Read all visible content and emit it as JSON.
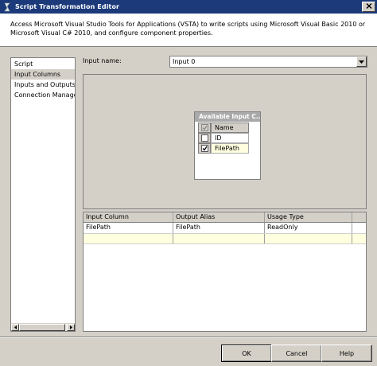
{
  "window": {
    "title": "Script Transformation Editor",
    "app_icon": "ssis-script-icon"
  },
  "header": {
    "description": "Access Microsoft Visual Studio Tools for Applications (VSTA) to write scripts using Microsoft Visual Basic 2010 or Microsoft Visual C# 2010, and configure component properties."
  },
  "sidebar": {
    "items": [
      {
        "label": "Script",
        "selected": false
      },
      {
        "label": "Input Columns",
        "selected": true
      },
      {
        "label": "Inputs and Outputs",
        "selected": false
      },
      {
        "label": "Connection Managers",
        "selected": false
      }
    ]
  },
  "input_name": {
    "label": "Input name:",
    "value": "Input 0"
  },
  "available_columns": {
    "title": "Available Input C...",
    "header": "Name",
    "header_checked": true,
    "rows": [
      {
        "name": "ID",
        "checked": false
      },
      {
        "name": "FilePath",
        "checked": true
      }
    ]
  },
  "mapping_grid": {
    "columns": [
      "Input Column",
      "Output Alias",
      "Usage Type"
    ],
    "rows": [
      [
        "FilePath",
        "FilePath",
        "ReadOnly"
      ]
    ]
  },
  "buttons": {
    "ok": "OK",
    "cancel": "Cancel",
    "help": "Help"
  },
  "colors": {
    "titlebar": "#1c3a7a",
    "dialog_bg": "#d4d0c8",
    "new_row": "#ffffe0"
  }
}
